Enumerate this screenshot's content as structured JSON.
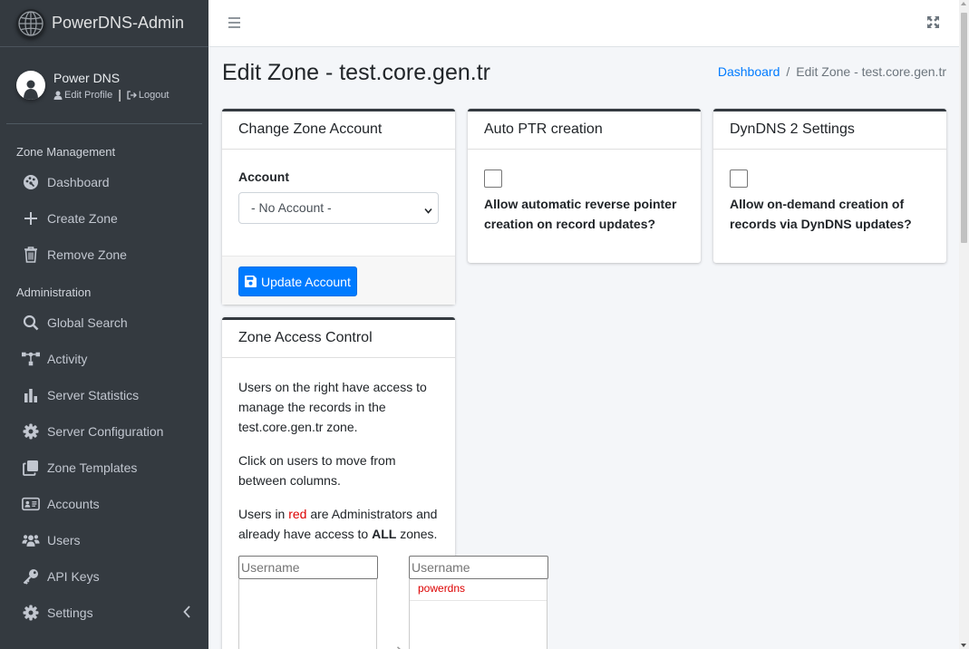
{
  "app": {
    "title": "PowerDNS-Admin"
  },
  "user": {
    "name": "Power DNS",
    "edit_profile": "Edit Profile",
    "logout": "Logout"
  },
  "sidebar": {
    "headers": {
      "zone_management": "Zone Management",
      "administration": "Administration"
    },
    "items": [
      {
        "label": "Dashboard",
        "icon": "palette-icon"
      },
      {
        "label": "Create Zone",
        "icon": "plus-icon"
      },
      {
        "label": "Remove Zone",
        "icon": "trash-icon"
      },
      {
        "label": "Global Search",
        "icon": "search-icon"
      },
      {
        "label": "Activity",
        "icon": "network-icon"
      },
      {
        "label": "Server Statistics",
        "icon": "bar-chart-icon"
      },
      {
        "label": "Server Configuration",
        "icon": "gear-icon"
      },
      {
        "label": "Zone Templates",
        "icon": "clone-icon"
      },
      {
        "label": "Accounts",
        "icon": "id-card-icon"
      },
      {
        "label": "Users",
        "icon": "users-icon"
      },
      {
        "label": "API Keys",
        "icon": "key-icon"
      },
      {
        "label": "Settings",
        "icon": "gear-icon"
      }
    ]
  },
  "page": {
    "title": "Edit Zone - test.core.gen.tr",
    "breadcrumb": {
      "home": "Dashboard",
      "divider": "/",
      "current": "Edit Zone - test.core.gen.tr"
    }
  },
  "cards": {
    "account": {
      "title": "Change Zone Account",
      "label": "Account",
      "selected": "- No Account -",
      "button": "Update Account"
    },
    "ptr": {
      "title": "Auto PTR creation",
      "checked": false,
      "label": "Allow automatic reverse pointer creation on record updates?"
    },
    "dyndns": {
      "title": "DynDNS 2 Settings",
      "checked": false,
      "label": "Allow on-demand creation of records via DynDNS updates?"
    },
    "access": {
      "title": "Zone Access Control",
      "p1": "Users on the right have access to manage the records in the test.core.gen.tr zone.",
      "p2": "Click on users to move from between columns.",
      "p3_pre": "Users in ",
      "p3_red": "red",
      "p3_mid": " are Administrators and already have access to ",
      "p3_bold": "ALL",
      "p3_post": " zones.",
      "left_placeholder": "Username",
      "right_placeholder": "Username",
      "right_users": [
        "powerdns"
      ]
    }
  },
  "colors": {
    "sidebar_bg": "#343a40",
    "primary": "#007bff",
    "admin_red": "#dd0000"
  }
}
